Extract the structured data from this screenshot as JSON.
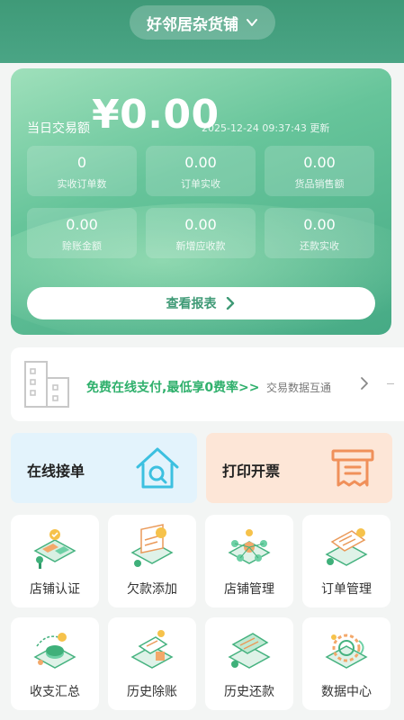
{
  "header": {
    "store_name": "好邻居杂货铺"
  },
  "summary": {
    "day_label": "当日交易额",
    "day_amount": "¥0.00",
    "update_time": "2025-12-24 09:37:43 更新",
    "stats": [
      {
        "value": "0",
        "label": "实收订单数"
      },
      {
        "value": "0.00",
        "label": "订单实收"
      },
      {
        "value": "0.00",
        "label": "货品销售额"
      },
      {
        "value": "0.00",
        "label": "赊账金额"
      },
      {
        "value": "0.00",
        "label": "新增应收款"
      },
      {
        "value": "0.00",
        "label": "还款实收"
      }
    ],
    "report_button": "查看报表"
  },
  "promo": {
    "main": "免费在线支付,最低享0费率>>",
    "sub": "交易数据互通"
  },
  "actions": {
    "online_orders": "在线接单",
    "print_invoice": "打印开票"
  },
  "grid": [
    {
      "label": "店铺认证"
    },
    {
      "label": "欠款添加"
    },
    {
      "label": "店铺管理"
    },
    {
      "label": "订单管理"
    },
    {
      "label": "收支汇总"
    },
    {
      "label": "历史除账"
    },
    {
      "label": "历史还款"
    },
    {
      "label": "数据中心"
    }
  ],
  "colors": {
    "brand": "#4aa585",
    "promo_green": "#2fb06c",
    "online_bg": "#e3f3fc",
    "print_bg": "#fde6d7"
  },
  "icons": {
    "store_selector": "chevron-down-icon",
    "report": "chevron-right-icon",
    "promo_left": "building-icon",
    "promo_right": "chevron-right-icon",
    "online_orders": "house-search-icon",
    "print_invoice": "printer-icon"
  }
}
